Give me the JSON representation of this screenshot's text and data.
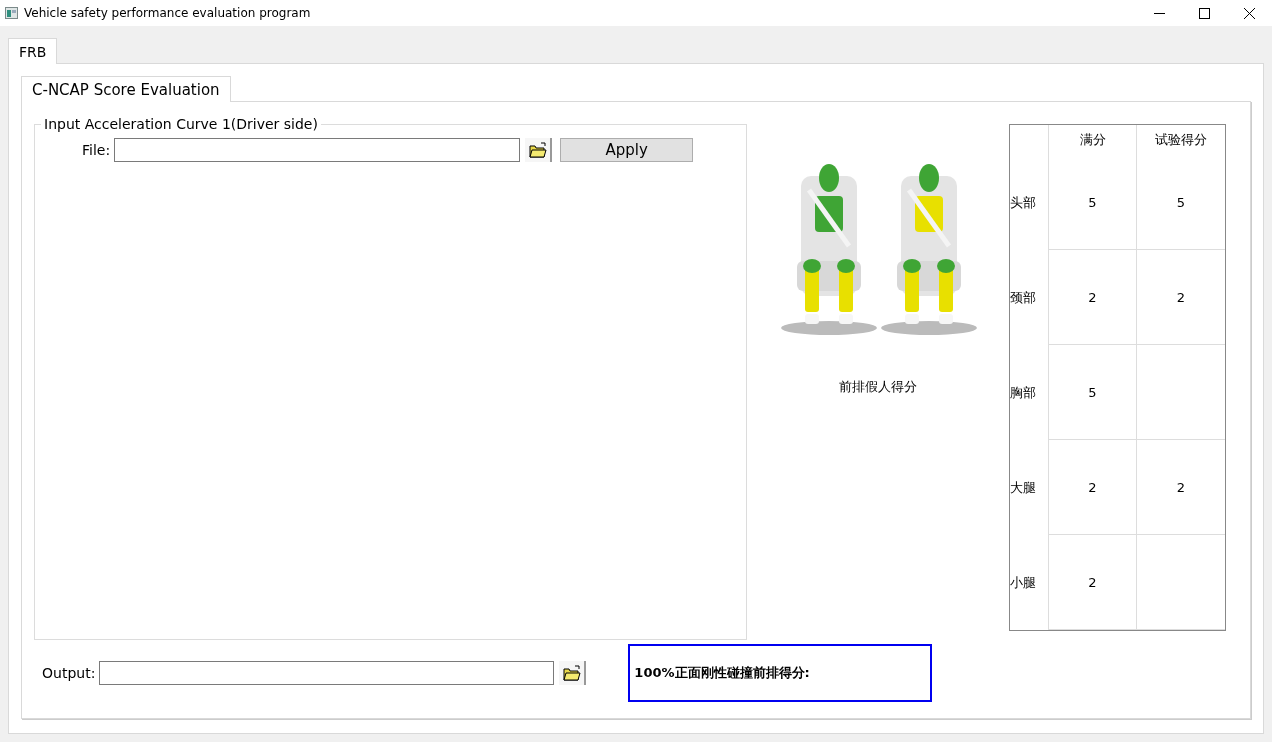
{
  "window": {
    "title": "Vehicle safety performance evaluation program"
  },
  "tabs": [
    {
      "label": "FRB",
      "selected": true
    }
  ],
  "subtabs": [
    {
      "label": "C-NCAP Score Evaluation",
      "selected": true
    }
  ],
  "input_group": {
    "title": "Input Acceleration Curve 1(Driver side)",
    "file_label": "File:",
    "apply_button": "Apply"
  },
  "dummy_figure": {
    "caption": "前排假人得分"
  },
  "score_table": {
    "columns": [
      "满分",
      "试验得分"
    ],
    "rows": [
      {
        "region": "头部",
        "full": "5",
        "test": "5"
      },
      {
        "region": "颈部",
        "full": "2",
        "test": "2"
      },
      {
        "region": "胸部",
        "full": "5"
      },
      {
        "region": "大腿",
        "full": "2",
        "test": "2"
      },
      {
        "region": "小腿",
        "full": "2"
      }
    ]
  },
  "output": {
    "label": "Output:"
  },
  "result": {
    "label": "100%正面刚性碰撞前排得分:"
  }
}
